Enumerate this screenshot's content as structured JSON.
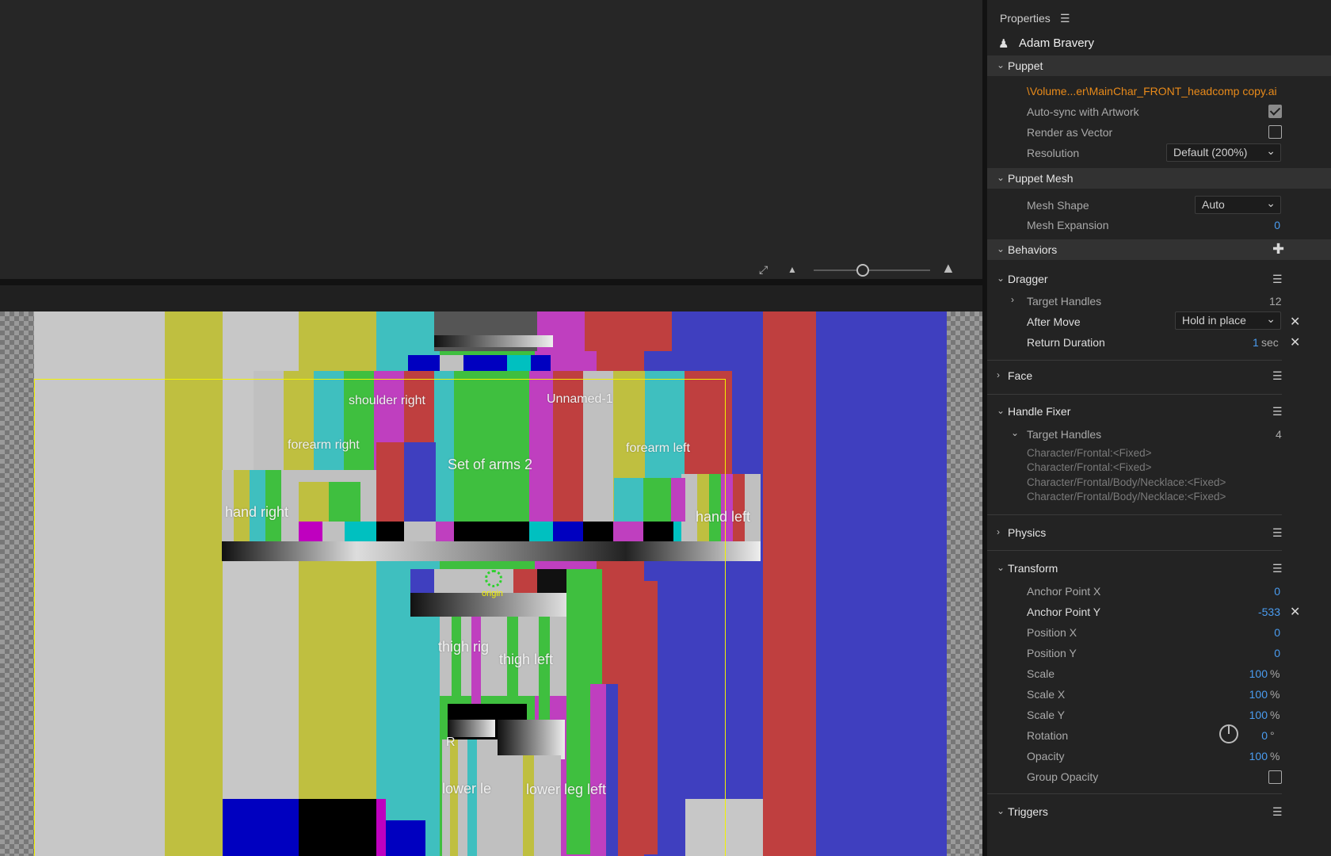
{
  "properties": {
    "title": "Properties",
    "puppet_name": "Adam Bravery",
    "puppet": {
      "header": "Puppet",
      "file_path": "\\Volume...er\\MainChar_FRONT_headcomp copy.ai",
      "auto_sync_label": "Auto-sync with Artwork",
      "render_vector_label": "Render as Vector",
      "resolution_label": "Resolution",
      "resolution_value": "Default (200%)"
    },
    "mesh": {
      "header": "Puppet Mesh",
      "shape_label": "Mesh Shape",
      "shape_value": "Auto",
      "expansion_label": "Mesh Expansion",
      "expansion_value": "0"
    },
    "behaviors": {
      "header": "Behaviors"
    },
    "dragger": {
      "header": "Dragger",
      "target_label": "Target Handles",
      "target_count": "12",
      "after_move_label": "After Move",
      "after_move_value": "Hold in place",
      "return_label": "Return Duration",
      "return_value": "1",
      "return_unit": "sec"
    },
    "face": {
      "header": "Face"
    },
    "handle_fixer": {
      "header": "Handle Fixer",
      "target_label": "Target Handles",
      "target_count": "4",
      "handles": [
        "Character/Frontal:<Fixed>",
        "Character/Frontal:<Fixed>",
        "Character/Frontal/Body/Necklace:<Fixed>",
        "Character/Frontal/Body/Necklace:<Fixed>"
      ]
    },
    "physics": {
      "header": "Physics"
    },
    "transform": {
      "header": "Transform",
      "rows": [
        {
          "label": "Anchor Point X",
          "value": "0",
          "unit": ""
        },
        {
          "label": "Anchor Point Y",
          "value": "-533",
          "unit": ""
        },
        {
          "label": "Position X",
          "value": "0",
          "unit": ""
        },
        {
          "label": "Position Y",
          "value": "0",
          "unit": ""
        },
        {
          "label": "Scale",
          "value": "100",
          "unit": "%"
        },
        {
          "label": "Scale X",
          "value": "100",
          "unit": "%"
        },
        {
          "label": "Scale Y",
          "value": "100",
          "unit": "%"
        },
        {
          "label": "Rotation",
          "value": "0",
          "unit": "°"
        },
        {
          "label": "Opacity",
          "value": "100",
          "unit": "%"
        }
      ],
      "group_opacity_label": "Group Opacity"
    },
    "triggers": {
      "header": "Triggers"
    }
  },
  "stage": {
    "labels": {
      "shoulder_right": "shoulder right",
      "unnamed": "Unnamed-1",
      "forearm_right": "forearm right",
      "set_of_arms": "Set of arms 2",
      "forearm_left": "forearm left",
      "hand_right": "hand right",
      "hand_left": "hand left",
      "thigh_right": "thigh rig",
      "thigh_left": "thigh left",
      "lower_right": "lower le",
      "lower_left": "lower leg left",
      "origin": "origin",
      "small_r": "R"
    }
  }
}
